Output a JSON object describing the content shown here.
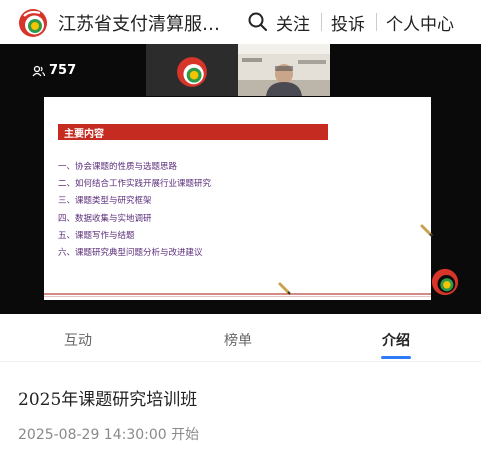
{
  "header": {
    "channel_title": "江苏省支付清算服…",
    "follow_label": "关注",
    "complain_label": "投诉",
    "user_center_label": "个人中心"
  },
  "video": {
    "viewer_count": "757",
    "slide": {
      "title": "主要内容",
      "items": [
        "一、协会课题的性质与选题思路",
        "二、如何结合工作实践开展行业课题研究",
        "三、课题类型与研究框架",
        "四、数据收集与实地调研",
        "五、课题写作与结题",
        "六、课题研究典型问题分析与改进建议"
      ]
    }
  },
  "tabs": [
    {
      "label": "互动",
      "active": false
    },
    {
      "label": "榜单",
      "active": false
    },
    {
      "label": "介绍",
      "active": true
    }
  ],
  "event": {
    "title": "2025年课题研究培训班",
    "time": "2025-08-29 14:30:00 开始"
  },
  "colors": {
    "brand_red": "#d8352a",
    "brand_green": "#2e9a4a",
    "brand_yellow": "#f5c400",
    "slide_header": "#c52b21",
    "tab_accent": "#2d7cf6"
  }
}
